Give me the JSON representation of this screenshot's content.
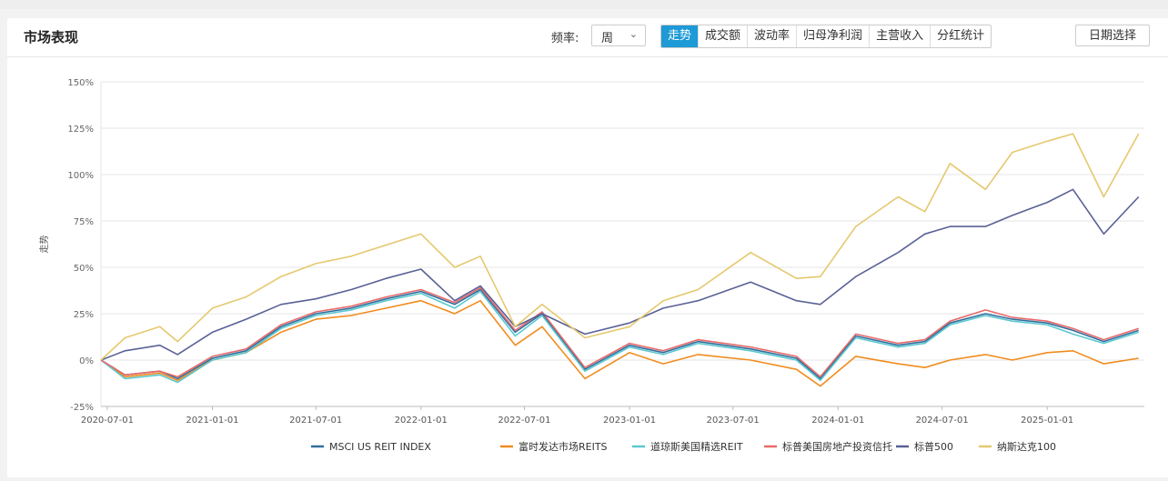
{
  "header": {
    "title": "市场表现",
    "freq_label": "频率:",
    "freq_value": "周",
    "tabs": [
      "走势",
      "成交额",
      "波动率",
      "归母净利润",
      "主营收入",
      "分红统计"
    ],
    "active_tab": 0,
    "date_button": "日期选择"
  },
  "chart_data": {
    "type": "line",
    "ylabel": "走势",
    "xlabel": "",
    "title": "",
    "ylim": [
      -25,
      150
    ],
    "yticks": [
      -25,
      0,
      25,
      50,
      75,
      100,
      125,
      150
    ],
    "ytick_labels": [
      "-25%",
      "0%",
      "25%",
      "50%",
      "75%",
      "100%",
      "125%",
      "150%"
    ],
    "xlim": [
      "2020-06-20",
      "2025-06-20"
    ],
    "xticks": [
      "2020-07-01",
      "2021-01-01",
      "2021-07-01",
      "2022-01-01",
      "2022-07-01",
      "2023-01-01",
      "2023-07-01",
      "2024-01-01",
      "2024-07-01",
      "2025-01-01"
    ],
    "grid": true,
    "legend_position": "bottom",
    "x": [
      "2020-06-20",
      "2020-08-01",
      "2020-10-01",
      "2020-11-01",
      "2021-01-01",
      "2021-03-01",
      "2021-05-01",
      "2021-07-01",
      "2021-09-01",
      "2021-11-01",
      "2022-01-01",
      "2022-03-01",
      "2022-04-15",
      "2022-06-15",
      "2022-08-01",
      "2022-10-15",
      "2023-01-01",
      "2023-03-01",
      "2023-05-01",
      "2023-08-01",
      "2023-10-20",
      "2023-12-01",
      "2024-02-01",
      "2024-04-15",
      "2024-06-01",
      "2024-07-15",
      "2024-09-15",
      "2024-11-01",
      "2025-01-01",
      "2025-02-15",
      "2025-04-10",
      "2025-06-10"
    ],
    "series": [
      {
        "name": "MSCI US REIT INDEX",
        "color": "#2f6e9e",
        "values": [
          0,
          -8,
          -6,
          -10,
          1,
          5,
          18,
          25,
          28,
          33,
          37,
          30,
          38,
          15,
          25,
          -5,
          8,
          4,
          10,
          6,
          1,
          -10,
          13,
          8,
          10,
          20,
          25,
          22,
          20,
          16,
          10,
          16
        ]
      },
      {
        "name": "富时发达市场REITS",
        "color": "#f08c1e",
        "values": [
          0,
          -9,
          -7,
          -11,
          0,
          4,
          15,
          22,
          24,
          28,
          32,
          25,
          32,
          8,
          18,
          -10,
          4,
          -2,
          3,
          0,
          -5,
          -14,
          2,
          -2,
          -4,
          0,
          3,
          0,
          4,
          5,
          -2,
          1
        ]
      },
      {
        "name": "道琼斯美国精选REIT",
        "color": "#5cc8cf",
        "values": [
          0,
          -10,
          -8,
          -12,
          0,
          4,
          17,
          24,
          27,
          32,
          36,
          28,
          37,
          13,
          24,
          -6,
          7,
          3,
          9,
          5,
          0,
          -11,
          12,
          7,
          9,
          19,
          24,
          21,
          19,
          14,
          9,
          15
        ]
      },
      {
        "name": "标普美国房地产投资信托",
        "color": "#e86a6a",
        "values": [
          0,
          -8,
          -6,
          -9,
          2,
          6,
          19,
          26,
          29,
          34,
          38,
          31,
          39,
          16,
          26,
          -4,
          9,
          5,
          11,
          7,
          2,
          -9,
          14,
          9,
          11,
          21,
          27,
          23,
          21,
          17,
          11,
          17
        ]
      },
      {
        "name": "标普500",
        "color": "#5a6196",
        "values": [
          0,
          5,
          8,
          3,
          15,
          22,
          30,
          33,
          38,
          44,
          49,
          32,
          40,
          18,
          25,
          14,
          20,
          28,
          32,
          42,
          32,
          30,
          45,
          58,
          68,
          72,
          72,
          78,
          85,
          92,
          68,
          88
        ]
      },
      {
        "name": "纳斯达克100",
        "color": "#e5c86e",
        "values": [
          0,
          12,
          18,
          10,
          28,
          34,
          45,
          52,
          56,
          62,
          68,
          50,
          56,
          18,
          30,
          12,
          18,
          32,
          38,
          58,
          44,
          45,
          72,
          88,
          80,
          106,
          92,
          112,
          118,
          122,
          88,
          122
        ]
      }
    ]
  }
}
